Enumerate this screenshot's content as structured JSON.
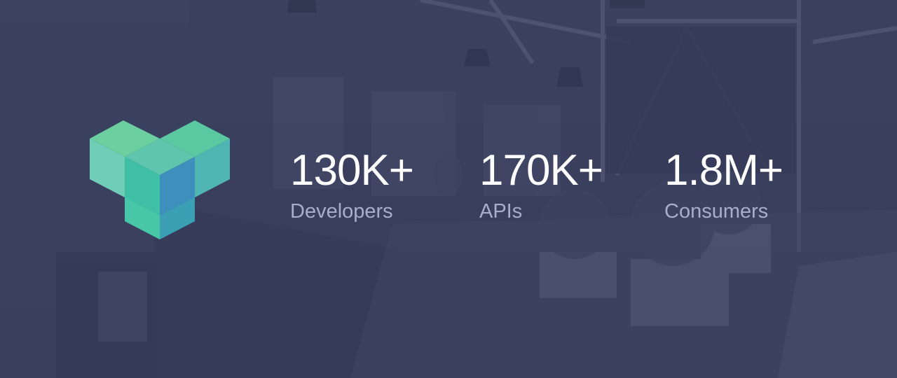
{
  "logo": {
    "name": "brand-logo",
    "colors": {
      "top_left": "#5ec9a5",
      "top_right": "#53c6a8",
      "mid_light": "#6fd0b4",
      "mid_dark": "#3aa5a8",
      "stem_left": "#4cbfaa",
      "stem_right": "#3f8fba"
    }
  },
  "stats": [
    {
      "value": "130K+",
      "label": "Developers"
    },
    {
      "value": "170K+",
      "label": "APIs"
    },
    {
      "value": "1.8M+",
      "label": "Consumers"
    }
  ],
  "colors": {
    "overlay": "#3c4462",
    "value_text": "#ffffff",
    "label_text": "#a7aecb"
  }
}
